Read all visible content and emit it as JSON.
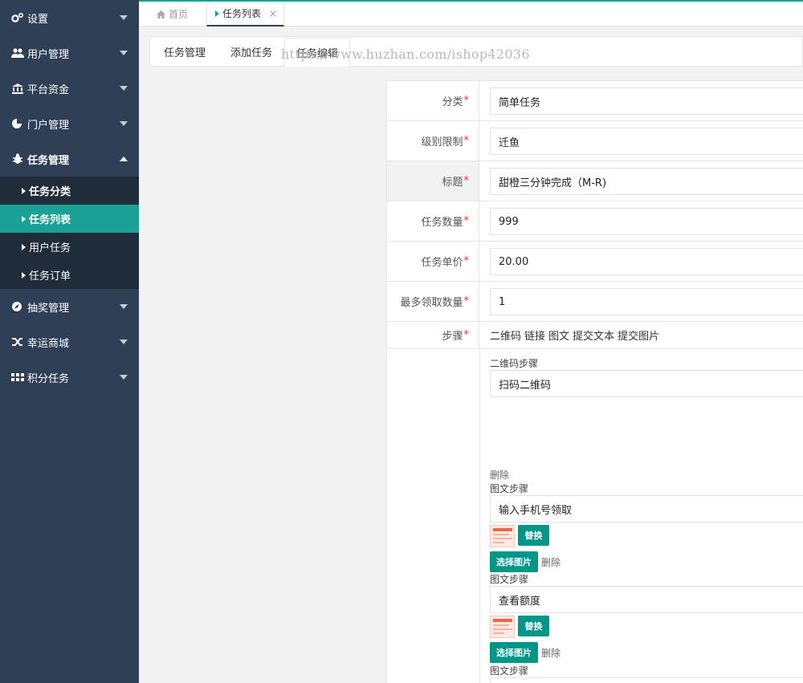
{
  "sidebar": {
    "items": [
      {
        "label": "设置",
        "icon": "gears-icon"
      },
      {
        "label": "用户管理",
        "icon": "users-icon"
      },
      {
        "label": "平台资金",
        "icon": "bank-icon"
      },
      {
        "label": "门户管理",
        "icon": "pie-icon"
      },
      {
        "label": "任务管理",
        "icon": "bug-icon"
      }
    ],
    "sub_items": [
      "任务分类",
      "任务列表",
      "用户任务",
      "任务订单"
    ],
    "items_after": [
      {
        "label": "抽奖管理",
        "icon": "compass-icon"
      },
      {
        "label": "幸运商城",
        "icon": "shuffle-icon"
      },
      {
        "label": "积分任务",
        "icon": "grid-icon"
      }
    ]
  },
  "topbar": {
    "home_label": "首页",
    "active_tab_label": "任务列表",
    "close_glyph": "×"
  },
  "subtabs": [
    "任务管理",
    "添加任务",
    "任务编辑"
  ],
  "watermark": "https://www.huzhan.com/ishop42036",
  "form": {
    "required_mark": "*",
    "category_label": "分类",
    "category_value": "简单任务",
    "level_label": "级别限制",
    "level_value": "迁鱼",
    "title_label": "标题",
    "title_value": "甜橙三分钟完成（M-R)",
    "count_label": "任务数量",
    "count_value": "999",
    "price_label": "任务单价",
    "price_value": "20.00",
    "max_label": "最多领取数量",
    "max_value": "1",
    "steps_label": "步骤",
    "step_types": [
      "二维码",
      "链接",
      "图文",
      "提交文本",
      "提交图片"
    ],
    "qr_title": "二维码步骤",
    "qr_value": "扫码二维码",
    "delete_label": "删除",
    "pic_title": "图文步骤",
    "pic_step1_value": "输入手机号领取",
    "pic_step2_value": "查看额度",
    "replace_label": "替换",
    "choose_label": "选择图片"
  },
  "colors": {
    "sidebar_bg": "#2f3f55",
    "sidebar_sub_bg": "#212c3a",
    "accent": "#1aa094",
    "button": "#009688"
  }
}
